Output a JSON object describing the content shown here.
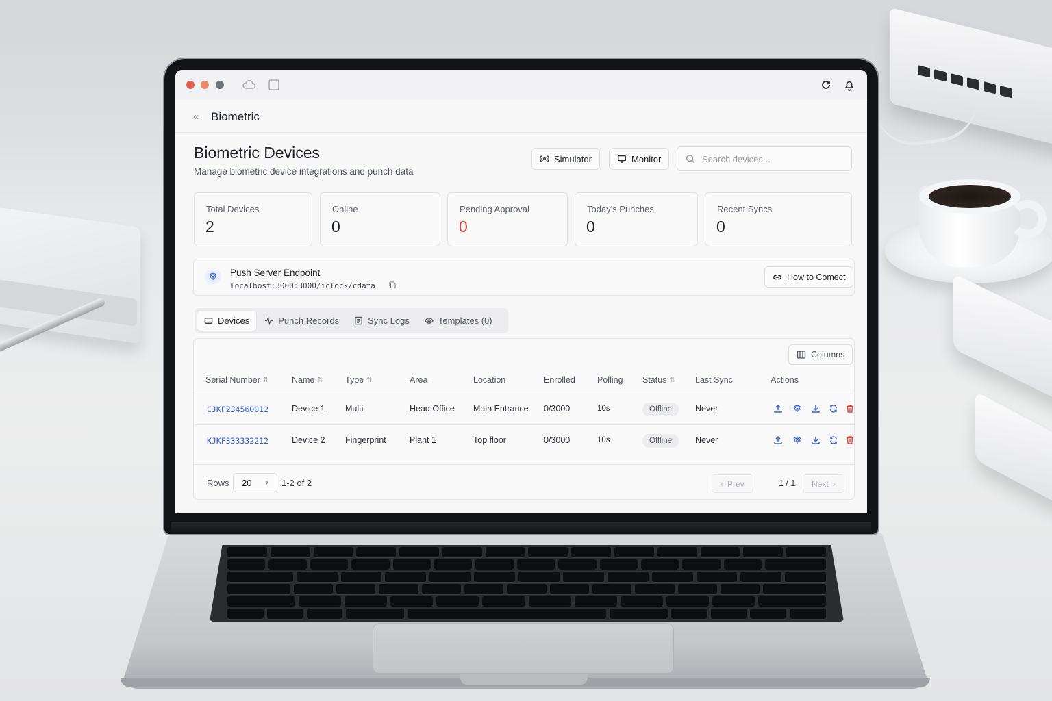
{
  "app": {
    "crumb": "Biometric",
    "page_title": "Biometric Devices",
    "page_subtitle": "Manage biometric device integrations and punch data"
  },
  "toolbar": {
    "simulator_label": "Simulator",
    "monitor_label": "Monitor",
    "search_placeholder": "Search devices..."
  },
  "stats": [
    {
      "label": "Total Devices",
      "value": "2"
    },
    {
      "label": "Online",
      "value": "0"
    },
    {
      "label": "Pending Approval",
      "value": "0",
      "color": "#d2483a"
    },
    {
      "label": "Today's Punches",
      "value": "0"
    },
    {
      "label": "Recent Syncs",
      "value": "0"
    }
  ],
  "endpoint": {
    "title": "Push Server Endpoint",
    "url": "localhost:3000:3000/iclock/cdata",
    "connect_label": "How to Comect"
  },
  "tabs": [
    {
      "label": "Devices",
      "icon": "device-icon",
      "active": true
    },
    {
      "label": "Punch Records",
      "icon": "activity-icon"
    },
    {
      "label": "Sync Logs",
      "icon": "log-icon"
    },
    {
      "label": "Templates (0)",
      "icon": "eye-icon"
    }
  ],
  "table": {
    "columns_button": "Columns",
    "headers": [
      "Serial Number",
      "Name",
      "Type",
      "Area",
      "Location",
      "Enrolled",
      "Polling",
      "Status",
      "Last Sync",
      "Actions"
    ],
    "rows": [
      {
        "serial": "CJKF234560012",
        "name": "Device 1",
        "type": "Multi",
        "area": "Head Office",
        "location": "Main Entrance",
        "enrolled": "0/3000",
        "polling": "10s",
        "status": "Offline",
        "last_sync": "Never"
      },
      {
        "serial": "KJKF333332212",
        "name": "Device 2",
        "type": "Fingerprint",
        "area": "Plant 1",
        "location": "Top floor",
        "enrolled": "0/3000",
        "polling": "10s",
        "status": "Offline",
        "last_sync": "Never"
      }
    ],
    "action_icons": [
      "upload-icon",
      "fingerprint-icon",
      "download-icon",
      "sync-icon",
      "trash-icon"
    ]
  },
  "pagination": {
    "rows_label": "Rows",
    "rows_value": "20",
    "range": "1-2 of 2",
    "prev_label": "Prev",
    "page_info": "1 / 1",
    "next_label": "Next"
  },
  "colors": {
    "accent_blue": "#2f5fd0",
    "danger_red": "#d2483a",
    "traffic_red": "#e0604e",
    "traffic_orange": "#e98a6e",
    "traffic_gray": "#6f737a"
  }
}
